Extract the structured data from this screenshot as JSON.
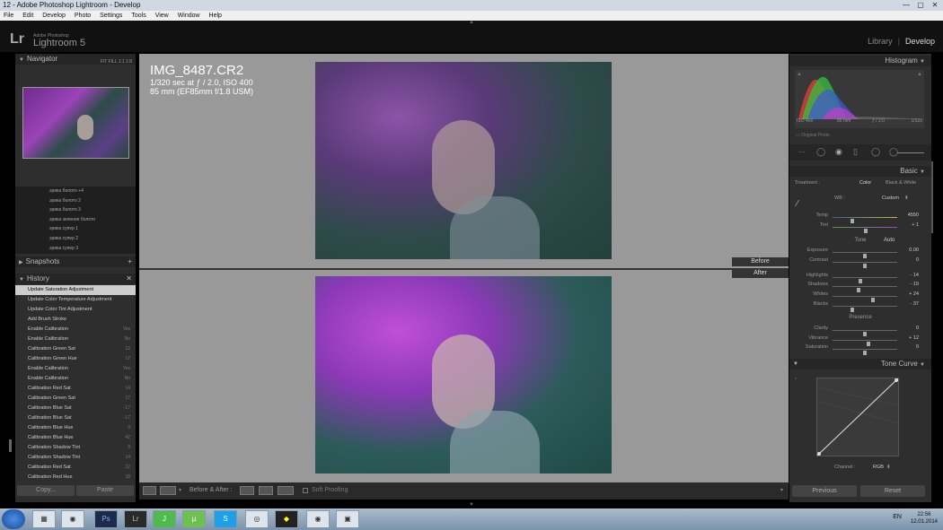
{
  "window": {
    "title": "12 - Adobe Photoshop Lightroom - Develop"
  },
  "menu": [
    "File",
    "Edit",
    "Develop",
    "Photo",
    "Settings",
    "Tools",
    "View",
    "Window",
    "Help"
  ],
  "app": {
    "logo": "Lr",
    "brand_small": "Adobe Photoshop",
    "brand": "Lightroom 5",
    "modules": [
      "Library",
      "Develop"
    ],
    "active_module": "Develop"
  },
  "navigator": {
    "title": "Navigator",
    "options": "FIT  FILL  1:1  1:8"
  },
  "presets": [
    "эрика болото +4",
    "эрика болото 2",
    "эрика болото 3",
    "эрика зеленое болото",
    "эрика супер 1",
    "эрика супер 2",
    "эрика супер 3"
  ],
  "snapshots": {
    "title": "Snapshots"
  },
  "history": {
    "title": "History",
    "items": [
      {
        "label": "Update Saturation Adjustment",
        "value": "",
        "selected": true
      },
      {
        "label": "Update Color Temperature Adjustment",
        "value": ""
      },
      {
        "label": "Update Color Tint Adjustment",
        "value": ""
      },
      {
        "label": "Add Brush Stroke",
        "value": ""
      },
      {
        "label": "Enable Calibration",
        "value": "Yes"
      },
      {
        "label": "Enable Calibration",
        "value": "No"
      },
      {
        "label": "Calibration Green Sat",
        "value": "12"
      },
      {
        "label": "Calibration Green Hue",
        "value": "17"
      },
      {
        "label": "Enable Calibration",
        "value": "Yes"
      },
      {
        "label": "Enable Calibration",
        "value": "No"
      },
      {
        "label": "Calibration Red Sat",
        "value": "14"
      },
      {
        "label": "Calibration Green Sat",
        "value": "17"
      },
      {
        "label": "Calibration Blue Sat",
        "value": "-17"
      },
      {
        "label": "Calibration Blue Sat",
        "value": "-17"
      },
      {
        "label": "Calibration Blue Hue",
        "value": "0"
      },
      {
        "label": "Calibration Blue Hue",
        "value": "42"
      },
      {
        "label": "Calibration Shadow Tint",
        "value": "9"
      },
      {
        "label": "Calibration Shadow Tint",
        "value": "14"
      },
      {
        "label": "Calibration Red Sat",
        "value": "12"
      },
      {
        "label": "Calibration Red Hue",
        "value": "18"
      }
    ]
  },
  "left_buttons": {
    "copy": "Copy...",
    "paste": "Paste"
  },
  "photo": {
    "filename": "IMG_8487.CR2",
    "exposure": "1/320 sec at ƒ / 2.0, ISO 400",
    "lens": "85 mm (EF85mm f/1.8 USM)"
  },
  "compare": {
    "before": "Before",
    "after": "After"
  },
  "toolbar": {
    "before_after": "Before & After :",
    "soft_proofing": "Soft Proofing"
  },
  "histogram": {
    "title": "Histogram",
    "iso": "ISO 400",
    "focal": "85 mm",
    "aperture": "ƒ / 2.0",
    "shutter": "1/320",
    "original": "Original Photo"
  },
  "basic": {
    "title": "Basic",
    "treatment_label": "Treatment :",
    "treatment_color": "Color",
    "treatment_bw": "Black & White",
    "wb_label": "WB :",
    "wb_value": "Custom",
    "tone_label": "Tone",
    "auto_label": "Auto",
    "presence_label": "Presence",
    "sliders": [
      {
        "label": "Temp",
        "value": "4550",
        "level": 0.3
      },
      {
        "label": "Tint",
        "value": "+ 1",
        "level": 0.51
      },
      {
        "label": "Exposure",
        "value": "0.00",
        "level": 0.5
      },
      {
        "label": "Contrast",
        "value": "0",
        "level": 0.5
      },
      {
        "label": "Highlights",
        "value": "- 14",
        "level": 0.43
      },
      {
        "label": "Shadows",
        "value": "- 19",
        "level": 0.4
      },
      {
        "label": "Whites",
        "value": "+ 24",
        "level": 0.62
      },
      {
        "label": "Blacks",
        "value": "- 37",
        "level": 0.31
      },
      {
        "label": "Clarity",
        "value": "0",
        "level": 0.5
      },
      {
        "label": "Vibrance",
        "value": "+ 12",
        "level": 0.56
      },
      {
        "label": "Saturation",
        "value": "0",
        "level": 0.5
      }
    ]
  },
  "tone_curve": {
    "title": "Tone Curve",
    "channel_label": "Channel :",
    "channel_value": "RGB"
  },
  "right_buttons": {
    "previous": "Previous",
    "reset": "Reset"
  },
  "taskbar": {
    "lang": "EN",
    "time": "22:56",
    "date": "12.01.2014"
  },
  "colors": {
    "accent": "#ffffff",
    "panel": "#2e2e2e",
    "canvas": "#999999"
  }
}
